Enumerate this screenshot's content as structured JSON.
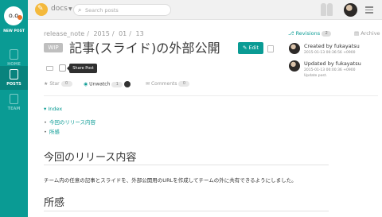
{
  "colors": {
    "accent": "#0a9b94",
    "logo": "#f4b93c",
    "tooltip": "#2f2f2f"
  },
  "leftnav": {
    "new_post_label": "NEW POST",
    "items": [
      {
        "label": "HOME",
        "icon": "home-icon"
      },
      {
        "label": "POSTS",
        "icon": "document-icon",
        "active": true
      },
      {
        "label": "TEAM",
        "icon": "team-icon"
      }
    ]
  },
  "topbar": {
    "team_name": "docs",
    "search_placeholder": "Search posts"
  },
  "post": {
    "breadcrumb": [
      "release_note",
      "2015",
      "01",
      "13"
    ],
    "wip_badge": "WIP",
    "title": "記事(スライド)の外部公開",
    "edit_label": "Edit",
    "tooltip": "Share Post",
    "star_label": "Star",
    "star_count": "0",
    "watch_label": "Unwatch",
    "watch_count": "1",
    "comments_label": "Comments",
    "comments_count": "0"
  },
  "toc": {
    "title": "Index",
    "items": [
      "今回のリリース内容",
      "所感"
    ]
  },
  "content": {
    "heading1": "今回のリリース内容",
    "paragraph": "チーム内の任意の記事とスライドを、外部公開用のURLを作成してチームの外に共有できるようにしました。",
    "heading2": "所感"
  },
  "sidebar": {
    "revisions_label": "Revisions",
    "revisions_count": "2",
    "archive_label": "Archive",
    "created_by": "Created by fukayatsu",
    "created_at": "2015-01-13 00:36:56 +0900",
    "updated_by": "Updated by fukayatsu",
    "updated_at": "2015-01-13 00:00:36 +0900",
    "updated_note": "Update post."
  }
}
